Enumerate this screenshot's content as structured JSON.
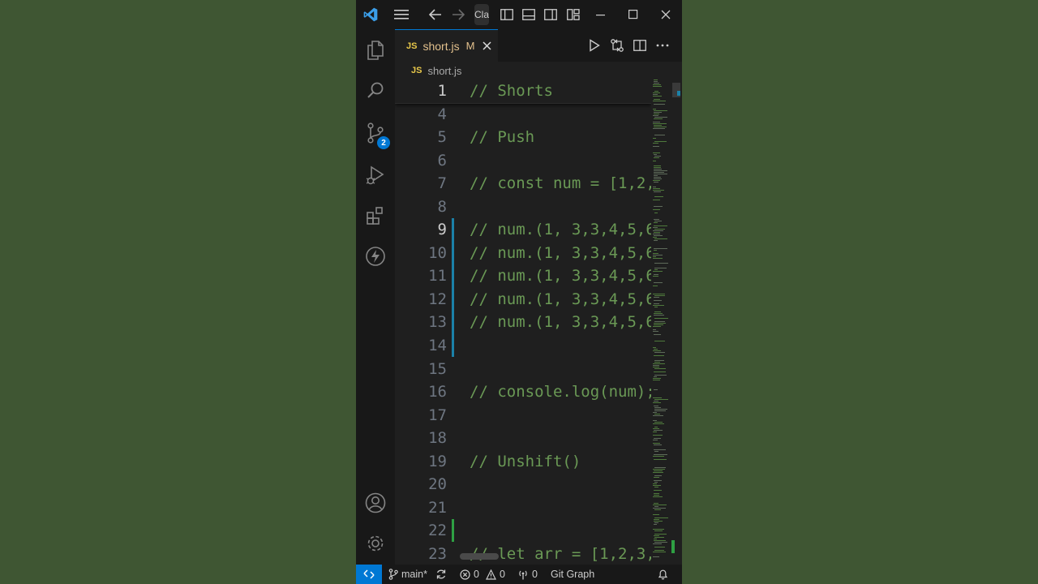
{
  "titlebar": {
    "search_fragment": "Cla",
    "icons": [
      "vscode-logo-icon",
      "menu-icon",
      "back-arrow-icon",
      "forward-arrow-icon",
      "toggle-primary-sidebar-icon",
      "toggle-panel-icon",
      "toggle-secondary-sidebar-icon",
      "customize-layout-icon",
      "minimize-icon",
      "maximize-icon",
      "close-icon"
    ]
  },
  "activity_bar": {
    "items": [
      "explorer-icon",
      "search-icon",
      "source-control-icon",
      "run-debug-icon",
      "extensions-icon",
      "lightning-icon"
    ],
    "source_control_badge": "2",
    "bottom": [
      "account-icon",
      "settings-gear-icon"
    ]
  },
  "tab": {
    "icon_label": "JS",
    "filename": "short.js",
    "status": "M"
  },
  "breadcrumb": {
    "icon_label": "JS",
    "filename": "short.js"
  },
  "editor": {
    "sticky": {
      "num": "1",
      "text": "// Shorts"
    },
    "lines": [
      {
        "num": "4",
        "text": ""
      },
      {
        "num": "5",
        "text": "// Push"
      },
      {
        "num": "6",
        "text": ""
      },
      {
        "num": "7",
        "text": "// const num = [1,2,"
      },
      {
        "num": "8",
        "text": ""
      },
      {
        "num": "9",
        "text": "// num.(1, 3,3,4,5,6"
      },
      {
        "num": "10",
        "text": "// num.(1, 3,3,4,5,6"
      },
      {
        "num": "11",
        "text": "// num.(1, 3,3,4,5,6"
      },
      {
        "num": "12",
        "text": "// num.(1, 3,3,4,5,6"
      },
      {
        "num": "13",
        "text": "// num.(1, 3,3,4,5,6"
      },
      {
        "num": "14",
        "text": ""
      },
      {
        "num": "15",
        "text": ""
      },
      {
        "num": "16",
        "text": "// console.log(num);"
      },
      {
        "num": "17",
        "text": ""
      },
      {
        "num": "18",
        "text": ""
      },
      {
        "num": "19",
        "text": "// Unshift()"
      },
      {
        "num": "20",
        "text": ""
      },
      {
        "num": "21",
        "text": ""
      },
      {
        "num": "22",
        "text": ""
      },
      {
        "num": "23",
        "text": "// let arr = [1,2,3,"
      }
    ],
    "active_line": "9"
  },
  "status_bar": {
    "branch": "main*",
    "errors": "0",
    "warnings": "0",
    "ports": "0",
    "git_graph": "Git Graph"
  },
  "colors": {
    "background": "#405733",
    "editor_bg": "#1f1f1f",
    "chrome_bg": "#181818",
    "comment": "#6a9955",
    "accent": "#0078d4",
    "modified_gutter": "#1b81a8",
    "added_gutter": "#2ea043"
  }
}
